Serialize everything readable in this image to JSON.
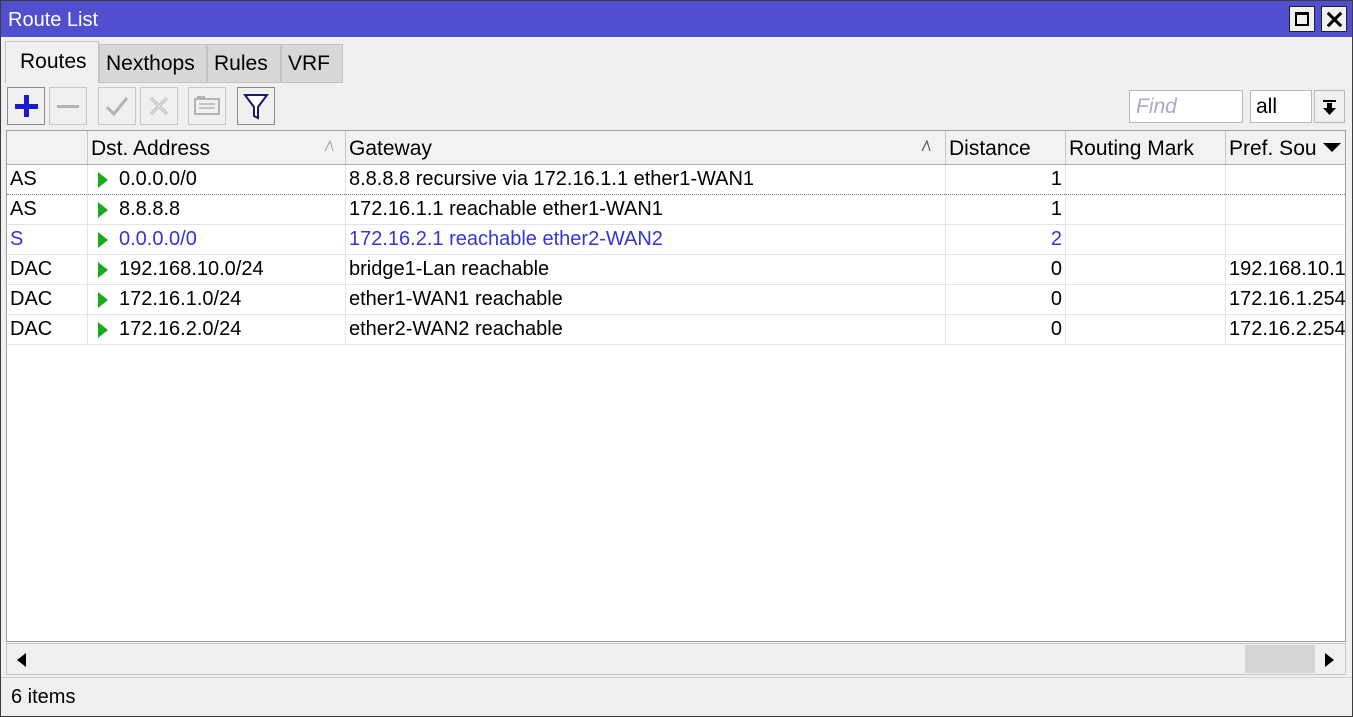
{
  "window": {
    "title": "Route List"
  },
  "tabs": [
    {
      "label": "Routes",
      "active": true
    },
    {
      "label": "Nexthops",
      "active": false
    },
    {
      "label": "Rules",
      "active": false
    },
    {
      "label": "VRF",
      "active": false
    }
  ],
  "toolbar": {
    "find_placeholder": "Find",
    "find_value": "",
    "filter_value": "all",
    "icons": [
      "add-icon",
      "remove-icon",
      "enable-icon",
      "disable-icon",
      "comment-icon",
      "filter-icon"
    ]
  },
  "table": {
    "columns": [
      "",
      "Dst. Address",
      "Gateway",
      "Distance",
      "Routing Mark",
      "Pref. Sou"
    ],
    "rows": [
      {
        "flags": "AS",
        "dst": "0.0.0.0/0",
        "gateway": "8.8.8.8 recursive via 172.16.1.1 ether1-WAN1",
        "distance": "1",
        "routing_mark": "",
        "pref_source": ""
      },
      {
        "flags": "AS",
        "dst": "8.8.8.8",
        "gateway": "172.16.1.1 reachable ether1-WAN1",
        "distance": "1",
        "routing_mark": "",
        "pref_source": ""
      },
      {
        "flags": "S",
        "dst": "0.0.0.0/0",
        "gateway": "172.16.2.1 reachable ether2-WAN2",
        "distance": "2",
        "routing_mark": "",
        "pref_source": ""
      },
      {
        "flags": "DAC",
        "dst": "192.168.10.0/24",
        "gateway": "bridge1-Lan reachable",
        "distance": "0",
        "routing_mark": "",
        "pref_source": "192.168.10.1"
      },
      {
        "flags": "DAC",
        "dst": "172.16.1.0/24",
        "gateway": "ether1-WAN1 reachable",
        "distance": "0",
        "routing_mark": "",
        "pref_source": "172.16.1.254"
      },
      {
        "flags": "DAC",
        "dst": "172.16.2.0/24",
        "gateway": "ether2-WAN2 reachable",
        "distance": "0",
        "routing_mark": "",
        "pref_source": "172.16.2.254"
      }
    ]
  },
  "status": {
    "items": "6 items"
  },
  "colors": {
    "titlebar": "#4f4fcf",
    "static_route": "#3535d6",
    "active_arrow": "#1cab1c",
    "add_icon": "#1a1ad0"
  }
}
